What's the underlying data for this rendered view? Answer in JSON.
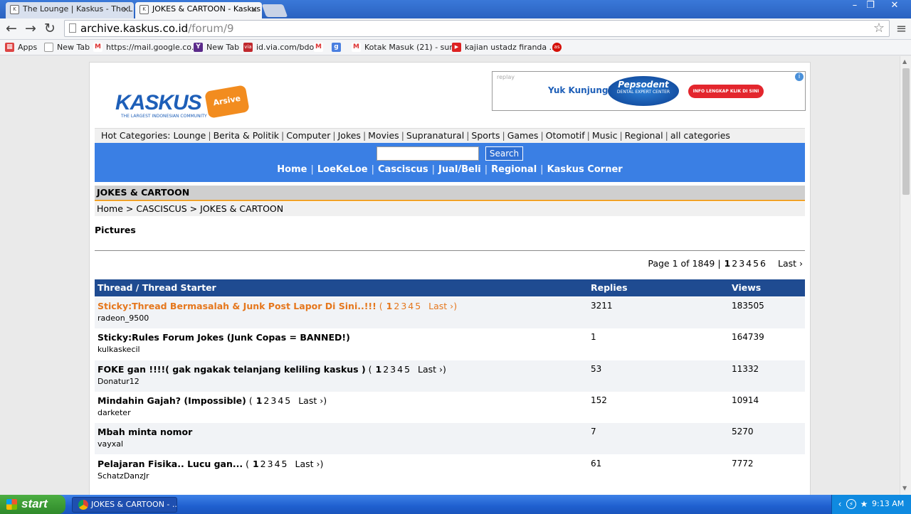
{
  "browser": {
    "tabs": [
      {
        "title": "The Lounge | Kaskus - The L",
        "active": false
      },
      {
        "title": "JOKES & CARTOON - Kaskus",
        "active": true
      }
    ],
    "url_host": "archive.kaskus.co.id",
    "url_path": "/forum/9",
    "bookmarks": [
      {
        "label": "Apps",
        "icon": "apps-grid-icon"
      },
      {
        "label": "New Tab",
        "icon": "page-icon"
      },
      {
        "label": "https://mail.google.co...",
        "icon": "gmail-icon"
      },
      {
        "label": "New Tab",
        "icon": "yahoo-icon"
      },
      {
        "label": "id.via.com/bdo",
        "icon": "via-icon"
      },
      {
        "label": "",
        "icon": "gmail-icon"
      },
      {
        "label": "",
        "icon": "google-icon"
      },
      {
        "label": "Kotak Masuk (21) - sur...",
        "icon": "gmail-icon"
      },
      {
        "label": "kajian ustadz firanda ...",
        "icon": "youtube-icon"
      },
      {
        "label": "",
        "icon": "lastfm-icon"
      }
    ]
  },
  "header": {
    "logo_text": "KASKUS",
    "logo_tagline": "THE LARGEST INDONESIAN COMMUNITY",
    "logo_badge": "Arsive",
    "ad": {
      "replay": "replay",
      "headline": "Yuk Kunjungi",
      "brand": "Pepsodent",
      "brand_sub": "DENTAL EXPERT CENTER",
      "cta": "INFO LENGKAP KLIK DI SINI"
    }
  },
  "hot_categories": {
    "label": "Hot Categories:",
    "items": [
      "Lounge",
      "Berita & Politik",
      "Computer",
      "Jokes",
      "Movies",
      "Supranatural",
      "Sports",
      "Games",
      "Otomotif",
      "Music",
      "Regional",
      "all categories"
    ]
  },
  "search": {
    "button": "Search",
    "value": ""
  },
  "main_nav": [
    "Home",
    "LoeKeLoe",
    "Casciscus",
    "Jual/Beli",
    "Regional",
    "Kaskus Corner"
  ],
  "forum": {
    "title": "JOKES & CARTOON",
    "breadcrumb": "Home > CASCISCUS > JOKES & CARTOON",
    "description": "Pictures"
  },
  "pager": {
    "summary": "Page 1 of 1849 |",
    "pages": [
      "1",
      "2",
      "3",
      "4",
      "5",
      "6"
    ],
    "current": "1",
    "last": "Last ›"
  },
  "table": {
    "headers": {
      "thread": "Thread / Thread Starter",
      "replies": "Replies",
      "views": "Views"
    },
    "rows": [
      {
        "title": "Sticky:Thread Bermasalah & Junk Post Lapor Di Sini..!!!",
        "sticky": true,
        "pages": [
          "1",
          "2",
          "3",
          "4",
          "5"
        ],
        "last": "Last ›",
        "starter": "radeon_9500",
        "replies": "3211",
        "views": "183505"
      },
      {
        "title": "Sticky:Rules Forum Jokes (Junk Copas = BANNED!)",
        "sticky": false,
        "pages": [],
        "last": "",
        "starter": "kulkaskecil",
        "replies": "1",
        "views": "164739"
      },
      {
        "title": "FOKE gan !!!!( gak ngakak telanjang keliling kaskus )",
        "sticky": false,
        "pages": [
          "1",
          "2",
          "3",
          "4",
          "5"
        ],
        "last": "Last ›",
        "starter": "Donatur12",
        "replies": "53",
        "views": "11332"
      },
      {
        "title": "Mindahin Gajah? (Impossible)",
        "sticky": false,
        "pages": [
          "1",
          "2",
          "3",
          "4",
          "5"
        ],
        "last": "Last ›",
        "starter": "darketer",
        "replies": "152",
        "views": "10914"
      },
      {
        "title": "Mbah minta nomor",
        "sticky": false,
        "pages": [],
        "last": "",
        "starter": "vayxal",
        "replies": "7",
        "views": "5270"
      },
      {
        "title": "Pelajaran Fisika.. Lucu gan...",
        "sticky": false,
        "pages": [
          "1",
          "2",
          "3",
          "4",
          "5"
        ],
        "last": "Last ›",
        "starter": "SchatzDanzJr",
        "replies": "61",
        "views": "7772"
      }
    ]
  },
  "taskbar": {
    "start": "start",
    "task": "JOKES & CARTOON - ...",
    "clock": "9:13 AM"
  },
  "colors": {
    "nav_blue": "#3a7fe4",
    "table_header": "#1f4b91",
    "sticky_orange": "#e5771d",
    "accent_underline": "#f0a22a"
  }
}
